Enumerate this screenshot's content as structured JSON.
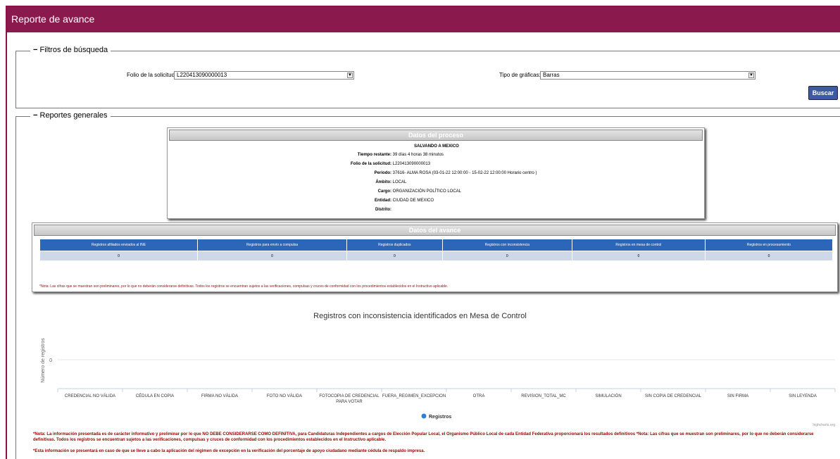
{
  "header": {
    "title": "Reporte de avance"
  },
  "filters": {
    "legend": "Filtros de búsqueda",
    "folio_label": "Folio de la solicitud:",
    "folio_value": "L220413090000013",
    "grafica_label": "Tipo de gráficas:",
    "grafica_value": "Barras",
    "search_label": "Buscar"
  },
  "reports": {
    "legend": "Reportes generales"
  },
  "proceso": {
    "title": "Datos del proceso",
    "name": "SALVANDO A MEXICO",
    "rows": [
      {
        "k": "Tiempo restante:",
        "v": "39 días  4 horas  38 minutos"
      },
      {
        "k": "Folio de la solicitud:",
        "v": "L220413090000013"
      },
      {
        "k": "Periodo:",
        "v": "37616- ALMA ROSA (03-01-22 12:00:00 - 15-02-22 12:00:00 Horario centro )"
      },
      {
        "k": "Ámbito:",
        "v": "LOCAL"
      },
      {
        "k": "Cargo:",
        "v": "ORGANIZACIÓN POLÍTICO LOCAL"
      },
      {
        "k": "Entidad:",
        "v": "CIUDAD DE MEXICO"
      },
      {
        "k": "Distrito:",
        "v": ""
      }
    ]
  },
  "avance": {
    "title": "Datos del avance",
    "headers": [
      "Registros afiliados enviados al INE",
      "Registros para envío a compulsa",
      "Registros duplicados",
      "Registros con inconsistencia",
      "Registros en mesa de control",
      "Registros en procesamiento"
    ],
    "values": [
      "0",
      "0",
      "0",
      "0",
      "0",
      "0"
    ],
    "note": "*Nota: Las cifras que se muestran son preliminares, por lo que no deberán considerarse definitivas. Todos los registros se encuentran sujetos a las verificaciones, compulsas y cruces de conformidad con los procedimientos establecidos en el Instructivo aplicable."
  },
  "chart_data": {
    "type": "bar",
    "title": "Registros con inconsistencia identificados en Mesa de Control",
    "ylabel": "Número de registros",
    "yticks": [
      "0"
    ],
    "categories": [
      "CREDENCIAL NO VÁLIDA",
      "CÉDULA EN COPIA",
      "FIRMA NO VÁLIDA",
      "FOTO NO VÁLIDA",
      "FOTOCOPIA DE CREDENCIAL PARA VOTAR",
      "FUERA_REGIMEN_EXCEPCION",
      "OTRA",
      "REVISION_TOTAL_MC",
      "SIMULACIÓN",
      "SIN COPIA DE CREDENCIAL",
      "SIN FIRMA",
      "SIN LEYENDA"
    ],
    "series": [
      {
        "name": "Registros",
        "values": [
          0,
          0,
          0,
          0,
          0,
          0,
          0,
          0,
          0,
          0,
          0,
          0
        ],
        "color": "#2f7ed8"
      }
    ],
    "legend": "bottom-center",
    "credits": "highcharts.org"
  },
  "footer": {
    "note1": "*Nota: La información presentada es de carácter informativo y preliminar por lo que NO DEBE CONSIDERARSE COMO DEFINITIVA, para Candidaturas Independientes a cargos de Elección Popular Local, el Organismo Público Local de cada Entidad Federativa proporcionará los resultados definitivos *Nota: Las cifras que se muestran son preliminares, por lo que no deberán considerarse definitivas. Todos los registros se encuentran sujetos a las verificaciones, compulsas y cruces de conformidad con los procedimientos establecidos en el Instructivo aplicable.",
    "note2": "*Esta información se presentará en caso de que se lleve a cabo la aplicación del régimen de excepción en la verificación del porcentaje de apoyo ciudadano mediante cédula de respaldo impresa."
  }
}
